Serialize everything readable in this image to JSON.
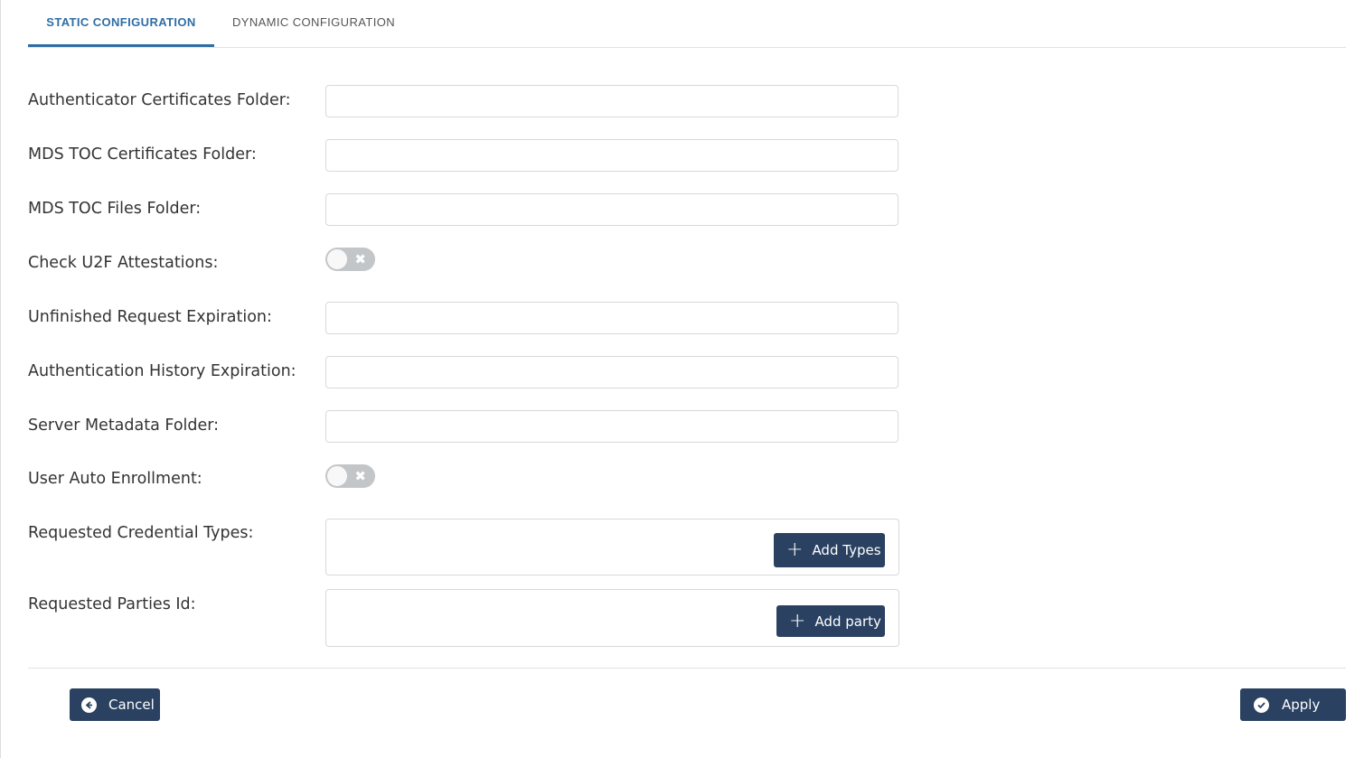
{
  "tabs": {
    "static": "STATIC CONFIGURATION",
    "dynamic": "DYNAMIC CONFIGURATION"
  },
  "form": {
    "auth_cert_folder": {
      "label": "Authenticator Certificates Folder:",
      "value": ""
    },
    "mds_toc_cert_folder": {
      "label": "MDS TOC Certificates Folder:",
      "value": ""
    },
    "mds_toc_files_folder": {
      "label": "MDS TOC Files Folder:",
      "value": ""
    },
    "check_u2f": {
      "label": "Check U2F Attestations:",
      "enabled": false,
      "off_glyph": "✖"
    },
    "unfinished_request_expiration": {
      "label": "Unfinished Request Expiration:",
      "value": ""
    },
    "auth_history_expiration": {
      "label": "Authentication History Expiration:",
      "value": ""
    },
    "server_metadata_folder": {
      "label": "Server Metadata Folder:",
      "value": ""
    },
    "user_auto_enrollment": {
      "label": "User Auto Enrollment:",
      "enabled": false,
      "off_glyph": "✖"
    },
    "requested_credential_types": {
      "label": "Requested Credential Types:",
      "button": "Add Types",
      "icon": "plus-icon"
    },
    "requested_parties_id": {
      "label": "Requested Parties Id:",
      "button": "Add party",
      "icon": "plus-icon"
    }
  },
  "footer": {
    "cancel": "Cancel",
    "apply": "Apply",
    "cancel_icon": "arrow-left-circle-icon",
    "apply_icon": "check-circle-icon"
  },
  "colors": {
    "accent": "#2e6da4",
    "button": "#2a4161",
    "toggle_off": "#c3c6c9"
  }
}
